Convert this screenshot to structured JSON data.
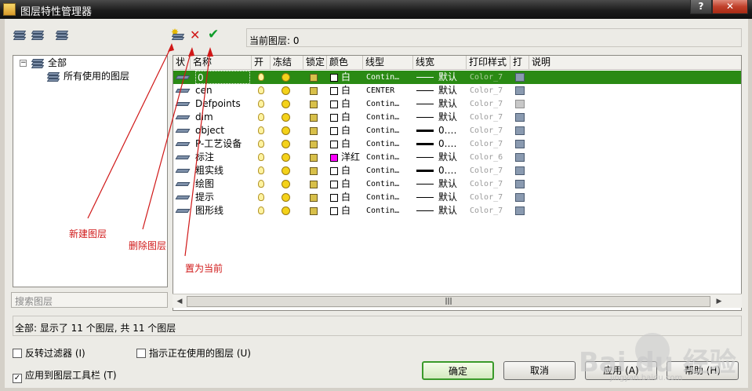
{
  "window": {
    "title": "图层特性管理器",
    "help_glyph": "?",
    "close_glyph": "✕"
  },
  "toolbar": {
    "icons": [
      "new-property-filter-icon",
      "new-group-filter-icon",
      "layer-states-manager-icon",
      "new-layer-icon",
      "delete-layer-icon",
      "set-current-icon"
    ],
    "current_layer_label": "当前图层: 0"
  },
  "tree": {
    "expander": "−",
    "root": "全部",
    "child": "所有使用的图层",
    "search_placeholder": "搜索图层"
  },
  "grid": {
    "columns": [
      "状",
      "名称",
      "开",
      "冻结",
      "锁定",
      "颜色",
      "线型",
      "线宽",
      "打印样式",
      "打",
      "说明"
    ],
    "rows": [
      {
        "name": "0",
        "color": "白",
        "swatch": "#ffffff",
        "linetype": "Contin…",
        "lineweight": "默认",
        "lw_style": "thin",
        "plot_style": "Color_7",
        "plot_enabled": true,
        "selected": true
      },
      {
        "name": "cen",
        "color": "白",
        "swatch": "#ffffff",
        "linetype": "CENTER",
        "lineweight": "默认",
        "lw_style": "thin",
        "plot_style": "Color_7",
        "plot_enabled": true,
        "selected": false
      },
      {
        "name": "Defpoints",
        "color": "白",
        "swatch": "#ffffff",
        "linetype": "Contin…",
        "lineweight": "默认",
        "lw_style": "thin",
        "plot_style": "Color_7",
        "plot_enabled": false,
        "selected": false
      },
      {
        "name": "dim",
        "color": "白",
        "swatch": "#ffffff",
        "linetype": "Contin…",
        "lineweight": "默认",
        "lw_style": "thin",
        "plot_style": "Color_7",
        "plot_enabled": true,
        "selected": false
      },
      {
        "name": "object",
        "color": "白",
        "swatch": "#ffffff",
        "linetype": "Contin…",
        "lineweight": "0.…",
        "lw_style": "thick",
        "plot_style": "Color_7",
        "plot_enabled": true,
        "selected": false
      },
      {
        "name": "P-工艺设备",
        "color": "白",
        "swatch": "#ffffff",
        "linetype": "Contin…",
        "lineweight": "0.…",
        "lw_style": "thick",
        "plot_style": "Color_7",
        "plot_enabled": true,
        "selected": false
      },
      {
        "name": "标注",
        "color": "洋红",
        "swatch": "#ff00ff",
        "linetype": "Contin…",
        "lineweight": "默认",
        "lw_style": "thin",
        "plot_style": "Color_6",
        "plot_enabled": true,
        "selected": false
      },
      {
        "name": "粗实线",
        "color": "白",
        "swatch": "#ffffff",
        "linetype": "Contin…",
        "lineweight": "0.…",
        "lw_style": "thick",
        "plot_style": "Color_7",
        "plot_enabled": true,
        "selected": false
      },
      {
        "name": "绘图",
        "color": "白",
        "swatch": "#ffffff",
        "linetype": "Contin…",
        "lineweight": "默认",
        "lw_style": "thin",
        "plot_style": "Color_7",
        "plot_enabled": true,
        "selected": false
      },
      {
        "name": "提示",
        "color": "白",
        "swatch": "#ffffff",
        "linetype": "Contin…",
        "lineweight": "默认",
        "lw_style": "thin",
        "plot_style": "Color_7",
        "plot_enabled": true,
        "selected": false
      },
      {
        "name": "图形线",
        "color": "白",
        "swatch": "#ffffff",
        "linetype": "Contin…",
        "lineweight": "默认",
        "lw_style": "thin",
        "plot_style": "Color_7",
        "plot_enabled": true,
        "selected": false
      }
    ],
    "scroll_thumb_grip": "|||",
    "scroll_left": "◀",
    "scroll_right": "▶"
  },
  "status": "全部: 显示了 11 个图层, 共 11 个图层",
  "options": {
    "invert_filter": {
      "label": "反转过滤器 (I)",
      "checked": false
    },
    "indicate_in_use": {
      "label": "指示正在使用的图层 (U)",
      "checked": false
    },
    "apply_to_toolbar": {
      "label": "应用到图层工具栏 (T)",
      "checked": true
    }
  },
  "buttons": {
    "ok": "确定",
    "cancel": "取消",
    "apply": "应用 (A)",
    "help": "帮助 (H)"
  },
  "annotations": {
    "new_layer": "新建图层",
    "delete_layer": "删除图层",
    "set_current": "置为当前",
    "color": "#d01818"
  },
  "watermark": {
    "text": "Bai du 经验",
    "sub": "jingyan.baidu.com"
  }
}
